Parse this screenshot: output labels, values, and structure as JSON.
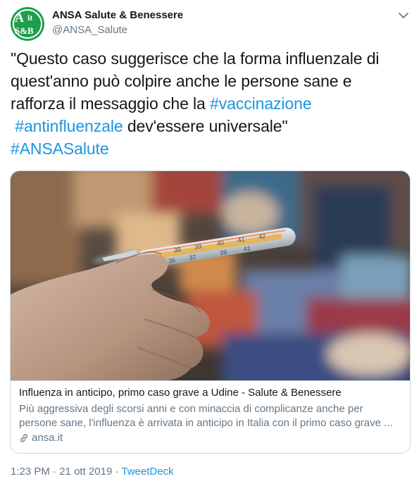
{
  "author": {
    "display_name": "ANSA Salute & Benessere",
    "handle": "@ANSA_Salute",
    "avatar": {
      "logo_top": "A",
      "logo_it": "it",
      "logo_bottom": "S&B",
      "color": "#1e9e4a"
    }
  },
  "icons": {
    "menu": "chevron-down-icon",
    "link": "link-icon"
  },
  "tweet": {
    "line1": "\"Questo caso suggerisce che la forma influenzale di",
    "line2": "quest'anno può colpire anche le persone sane e",
    "line3_prefix": "rafforza il messaggio che la ",
    "hashtag_vaccinazione": "#vaccinazione",
    "hashtag_antinfluenzale": "#antinfluenzale",
    "line4_suffix": " dev'essere universale\"",
    "hashtag_ansasalute": "#ANSASalute"
  },
  "card": {
    "title": "Influenza in anticipo, primo caso grave a Udine - Salute & Benessere",
    "description_line1": "Più aggressiva degli scorsi anni e con minaccia di complicanze anche per",
    "description_line2": "persone sane, l'influenza è arrivata in anticipo in Italia con il primo caso grave ...",
    "domain": "ansa.it",
    "thermometer_ticks_top": [
      "38",
      "39",
      "40",
      "41",
      "42"
    ],
    "thermometer_ticks_bottom": [
      "36",
      "37",
      "39",
      "41"
    ]
  },
  "meta": {
    "time": "1:23 PM",
    "separator1": " · ",
    "date": "21 ott 2019",
    "separator2": " · ",
    "source": "TweetDeck"
  },
  "colors": {
    "link": "#1b95e0",
    "secondary_text": "#657786",
    "border": "#ccd6dd"
  }
}
